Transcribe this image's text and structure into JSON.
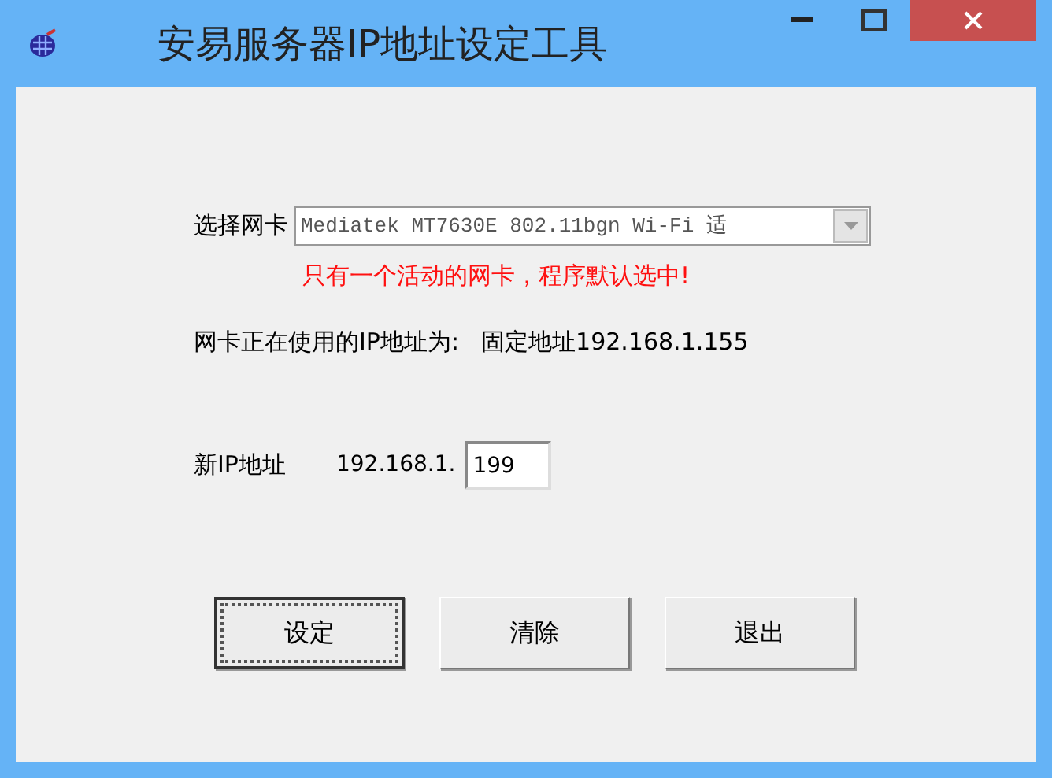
{
  "window": {
    "title": "安易服务器IP地址设定工具"
  },
  "adapter": {
    "label": "选择网卡",
    "value": "Mediatek MT7630E 802.11bgn Wi-Fi 适"
  },
  "notice": "只有一个活动的网卡，程序默认选中!",
  "current_ip": {
    "label": "网卡正在使用的IP地址为:",
    "value": "固定地址192.168.1.155"
  },
  "new_ip": {
    "label": "新IP地址",
    "prefix": "192.168.1.",
    "value": "199"
  },
  "buttons": [
    {
      "label": "设定",
      "focused": true
    },
    {
      "label": "清除",
      "focused": false
    },
    {
      "label": "退出",
      "focused": false
    }
  ]
}
